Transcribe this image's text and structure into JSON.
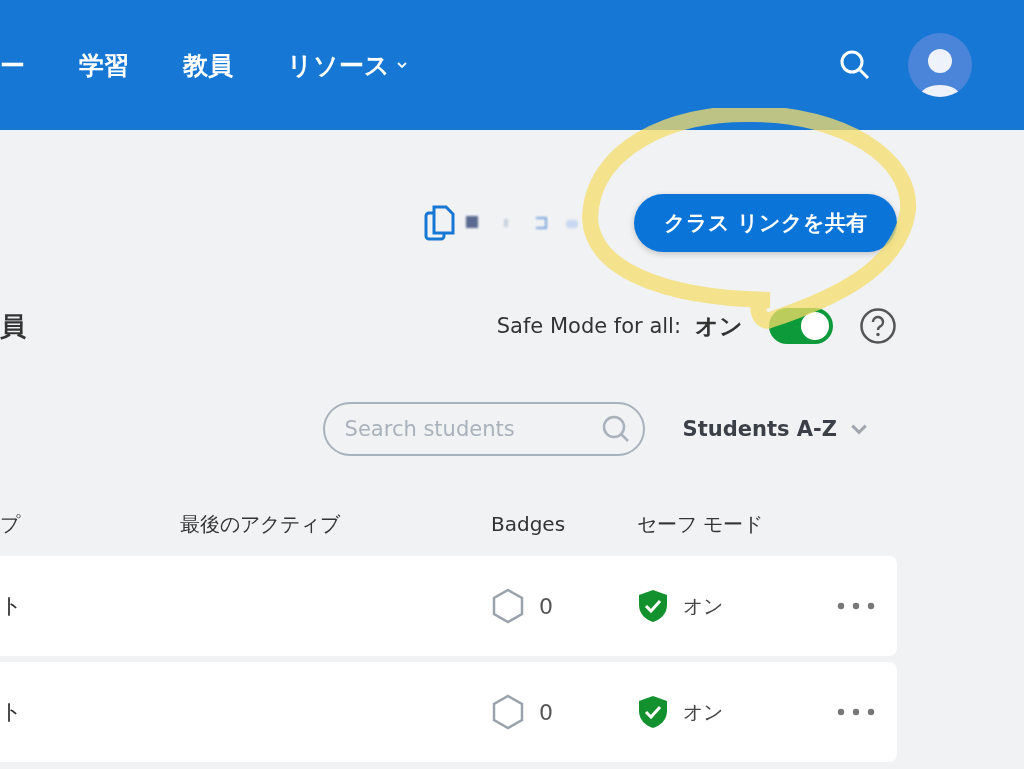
{
  "nav": {
    "items": [
      {
        "label": "ー",
        "has_menu": false
      },
      {
        "label": "学習",
        "has_menu": false
      },
      {
        "label": "教員",
        "has_menu": false
      },
      {
        "label": "リソース",
        "has_menu": true
      }
    ]
  },
  "share": {
    "button": "クラス リンクを共有"
  },
  "heading": "員",
  "safe_mode": {
    "label": "Safe Mode for all:",
    "value": "オン",
    "on": true
  },
  "search": {
    "placeholder": "Search students"
  },
  "sort": {
    "label": "Students A-Z"
  },
  "table": {
    "columns": [
      "プ",
      "最後のアクティブ",
      "Badges",
      "セーフ モード"
    ],
    "rows": [
      {
        "name": "ト",
        "badges": "0",
        "safe_mode": "オン",
        "safe_mode_on": true
      },
      {
        "name": "ト",
        "badges": "0",
        "safe_mode": "オン",
        "safe_mode_on": true
      }
    ]
  }
}
